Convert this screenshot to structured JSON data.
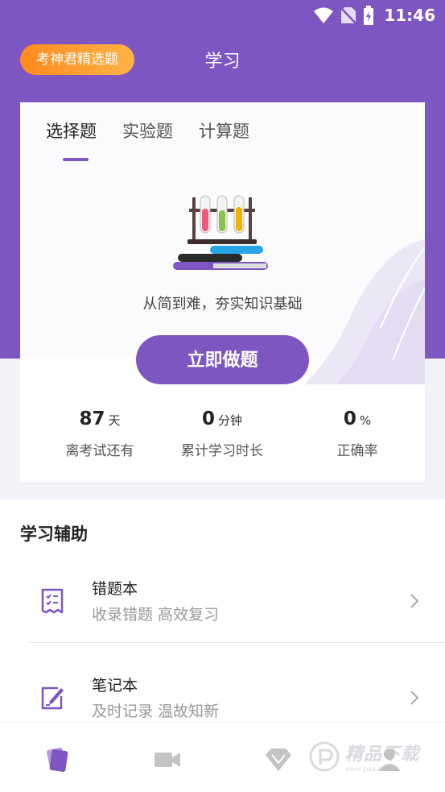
{
  "status_bar": {
    "time": "11:46"
  },
  "header": {
    "badge_label": "考神君精选题",
    "title": "学习"
  },
  "card": {
    "tabs": [
      {
        "label": "选择题"
      },
      {
        "label": "实验题"
      },
      {
        "label": "计算题"
      }
    ],
    "slogan": "从简到难，夯实知识基础",
    "start_button": "立即做题",
    "stats": [
      {
        "value": "87",
        "unit": "天",
        "label": "离考试还有"
      },
      {
        "value": "0",
        "unit": "分钟",
        "label": "累计学习时长"
      },
      {
        "value": "0",
        "unit": "%",
        "label": "正确率"
      }
    ]
  },
  "aids": {
    "section_title": "学习辅助",
    "items": [
      {
        "title": "错题本",
        "subtitle": "收录错题 高效复习",
        "icon": "checklist-icon"
      },
      {
        "title": "笔记本",
        "subtitle": "及时记录 温故知新",
        "icon": "edit-note-icon"
      }
    ]
  },
  "bottom_nav": {
    "items": [
      {
        "icon": "cards-icon",
        "active": true
      },
      {
        "icon": "video-icon",
        "active": false
      },
      {
        "icon": "diamond-icon",
        "active": false
      },
      {
        "icon": "profile-icon",
        "active": false
      }
    ]
  },
  "watermark": {
    "text": "精品下载",
    "url": "www.jpxz.com"
  },
  "colors": {
    "primary": "#7e56c2",
    "badge_start": "#ff8a1e",
    "badge_end": "#ffb347",
    "muted_text": "#999999"
  }
}
